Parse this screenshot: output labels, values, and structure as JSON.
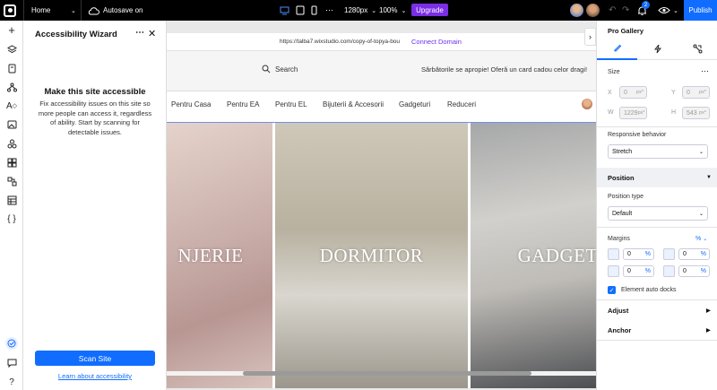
{
  "topbar": {
    "page_name": "Home",
    "autosave": "Autosave on",
    "width_value": "1280px",
    "zoom_value": "100%",
    "upgrade_label": "Upgrade",
    "notification_count": "2",
    "publish_label": "Publish"
  },
  "wizard": {
    "title": "Accessibility Wizard",
    "heading": "Make this site accessible",
    "description": "Fix accessibility issues on this site so more people can access it, regardless of ability. Start by scanning for detectable issues.",
    "scan_label": "Scan Site",
    "learn_link": "Learn about accessibility"
  },
  "site": {
    "url": "https://talba7.wixstudio.com/copy-of-topya-bou",
    "connect_domain": "Connect Domain",
    "search_label": "Search",
    "promo": "Sărbătorile se apropie! Oferă un card cadou celor dragi!",
    "nav_items": [
      "Pentru Casa",
      "Pentru EA",
      "Pentru EL",
      "Bijuterii & Accesorii",
      "Gadgeturi",
      "Reduceri"
    ],
    "panels": [
      "NJERIE",
      "DORMITOR",
      "GADGET-"
    ]
  },
  "inspector": {
    "title": "Pro Gallery",
    "size_label": "Size",
    "x_label": "X",
    "x_value": "0",
    "y_label": "Y",
    "y_value": "0",
    "w_label": "W",
    "w_value": "1229",
    "h_label": "H",
    "h_value": "543",
    "px_unit": "px*",
    "responsive_label": "Responsive behavior",
    "responsive_value": "Stretch",
    "position_section": "Position",
    "position_type_label": "Position type",
    "position_type_value": "Default",
    "margins_label": "Margins",
    "margins_unit": "%",
    "margin_top_left": "0",
    "margin_top_right": "0",
    "margin_bottom_left": "0",
    "margin_bottom_right": "0",
    "auto_docks_label": "Element auto docks",
    "adjust_section": "Adjust",
    "anchor_section": "Anchor"
  },
  "colors": {
    "accent": "#116dff",
    "upgrade": "#7a2ee6",
    "connect": "#6b2ef2"
  }
}
